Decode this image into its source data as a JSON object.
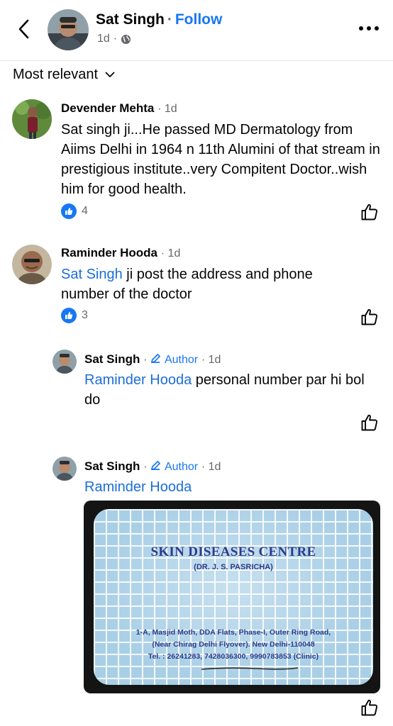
{
  "header": {
    "author_name": "Sat Singh",
    "separator": "·",
    "follow_label": "Follow",
    "time": "1d",
    "meta_separator": "·",
    "privacy_icon": "globe-icon",
    "more_icon": "more-horizontal-icon",
    "back_icon": "chevron-left-icon"
  },
  "sort": {
    "label": "Most relevant",
    "icon": "chevron-down-icon"
  },
  "comments": [
    {
      "name": "Devender Mehta",
      "meta": "· 1d",
      "text": "Sat singh ji...He passed MD Dermatology from Aiims Delhi in 1964 n 11th Alumini of that stream in prestigious institute..very Compitent Doctor..wish him for good health.",
      "reaction_count": "4"
    },
    {
      "name": "Raminder Hooda",
      "meta": "· 1d",
      "mention": "Sat Singh",
      "text": " ji post the address and phone number of the doctor",
      "reaction_count": "3"
    },
    {
      "name": "Sat Singh",
      "author_badge": "Author",
      "meta": "· 1d",
      "badge_separator": "·",
      "mention": "Raminder Hooda",
      "text": " personal number par hi bol do"
    },
    {
      "name": "Sat Singh",
      "author_badge": "Author",
      "meta": "· 1d",
      "badge_separator": "·",
      "mention": "Raminder Hooda"
    }
  ],
  "business_card": {
    "title": "SKIN DISEASES CENTRE",
    "subtitle": "(DR. J. S. PASRICHA)",
    "address_line1": "1-A, Masjid Moth, DDA Flats, Phase-I, Outer Ring Road,",
    "address_line2": "(Near Chirag Delhi Flyover). New Delhi-110048",
    "phone_line": "Tel. : 26241283, 7428036300, 9990783853 (Clinic)"
  },
  "colors": {
    "accent": "#1877f2",
    "mention": "#1a6ed8",
    "secondary_text": "#65676b",
    "card_blue": "#a9cfe6",
    "card_ink": "#2b3c8a"
  }
}
